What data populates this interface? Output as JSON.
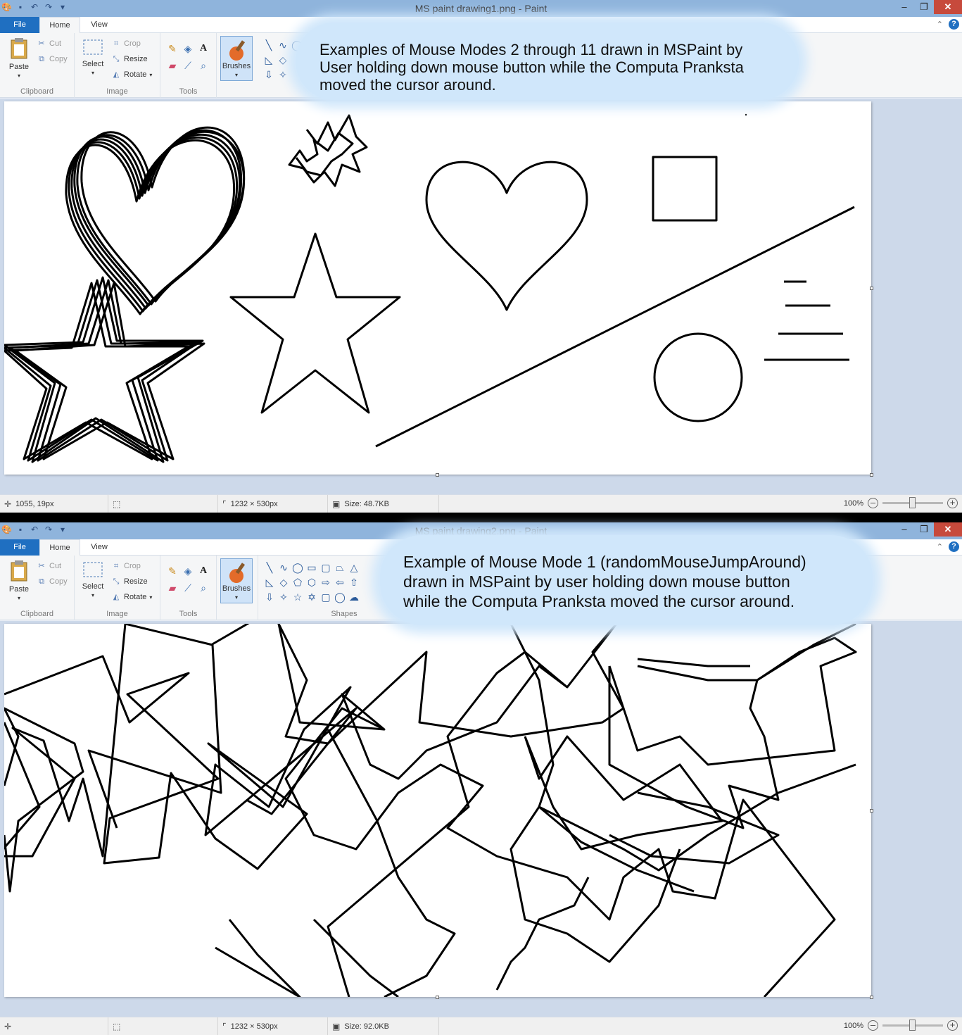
{
  "windows": [
    {
      "title": "MS paint drawing1.png - Paint",
      "tabs": {
        "file": "File",
        "home": "Home",
        "view": "View"
      },
      "ribbon": {
        "clipboard": {
          "label": "Clipboard",
          "paste": "Paste",
          "cut": "Cut",
          "copy": "Copy"
        },
        "image": {
          "label": "Image",
          "select": "Select",
          "crop": "Crop",
          "resize": "Resize",
          "rotate": "Rotate"
        },
        "tools": {
          "label": "Tools"
        },
        "brushes": "Brushes"
      },
      "status": {
        "cursor": "1055, 19px",
        "dimensions": "1232 × 530px",
        "size": "Size: 48.7KB",
        "zoom": "100%"
      }
    },
    {
      "title": "MS paint drawing2.png - Paint",
      "tabs": {
        "file": "File",
        "home": "Home",
        "view": "View"
      },
      "ribbon": {
        "clipboard": {
          "label": "Clipboard",
          "paste": "Paste",
          "cut": "Cut",
          "copy": "Copy"
        },
        "image": {
          "label": "Image",
          "select": "Select",
          "crop": "Crop",
          "resize": "Resize",
          "rotate": "Rotate"
        },
        "tools": {
          "label": "Tools"
        },
        "brushes": "Brushes",
        "shapes": {
          "label": "Shapes"
        }
      },
      "status": {
        "cursor": "",
        "dimensions": "1232 × 530px",
        "size": "Size: 92.0KB",
        "zoom": "100%"
      }
    }
  ],
  "callouts": {
    "top": [
      "Examples of Mouse Modes 2 through 11 drawn in MSPaint by",
      "User holding down mouse button while the Computa Pranksta",
      "moved the cursor around."
    ],
    "bottom": [
      "Example of Mouse Mode 1 (randomMouseJumpAround)",
      "drawn in MSPaint by user holding down mouse button",
      "while the Computa Pranksta moved the cursor around."
    ]
  },
  "icons": {
    "qat": [
      "paint-app-icon",
      "save-icon",
      "undo-icon",
      "redo-icon",
      "customize-icon"
    ],
    "tools": [
      "pencil-icon",
      "fill-icon",
      "text-icon",
      "eraser-icon",
      "color-picker-icon",
      "magnifier-icon"
    ],
    "status": [
      "cursor-position-icon",
      "selection-size-icon",
      "canvas-size-icon",
      "file-size-icon"
    ]
  },
  "colors": {
    "titlebar": "#8fb4dc",
    "file_tab": "#1f6fc1",
    "close": "#c74a3c",
    "callout": "#d0e7fb",
    "canvas_bg": "#cdd9ea"
  }
}
